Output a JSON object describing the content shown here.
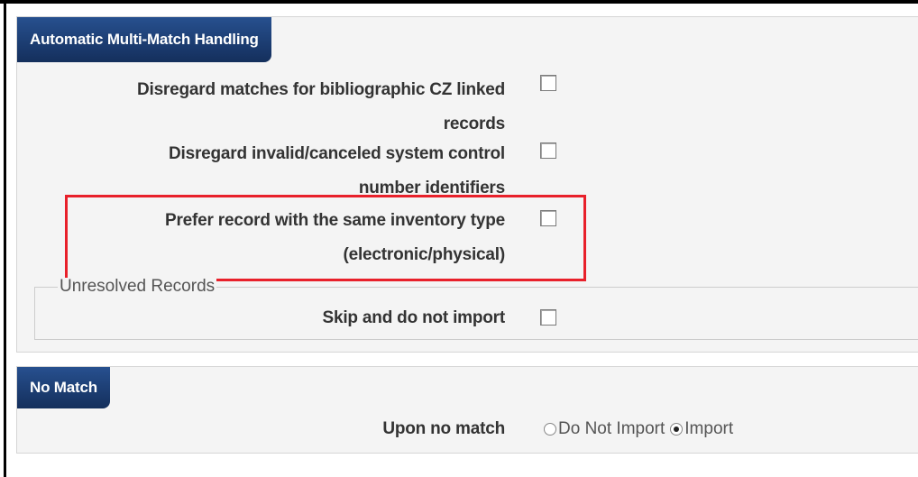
{
  "multi_match": {
    "header": "Automatic Multi-Match Handling",
    "rows": [
      {
        "label_line1": "Disregard matches for bibliographic CZ linked",
        "label_line2": "records",
        "checked": false
      },
      {
        "label_line1": "Disregard invalid/canceled system control",
        "label_line2": "number identifiers",
        "checked": false
      },
      {
        "label_line1": "Prefer record with the same inventory type",
        "label_line2": "(electronic/physical)",
        "checked": false
      }
    ],
    "unresolved": {
      "legend": "Unresolved Records",
      "label": "Skip and do not import",
      "checked": false
    }
  },
  "no_match": {
    "header": "No Match",
    "label": "Upon no match",
    "options": [
      {
        "label": "Do Not Import",
        "selected": false
      },
      {
        "label": "Import",
        "selected": true
      }
    ]
  },
  "colors": {
    "header_bg": "#1c3d73",
    "highlight": "#e8202a",
    "section_bg": "#f4f4f4"
  }
}
